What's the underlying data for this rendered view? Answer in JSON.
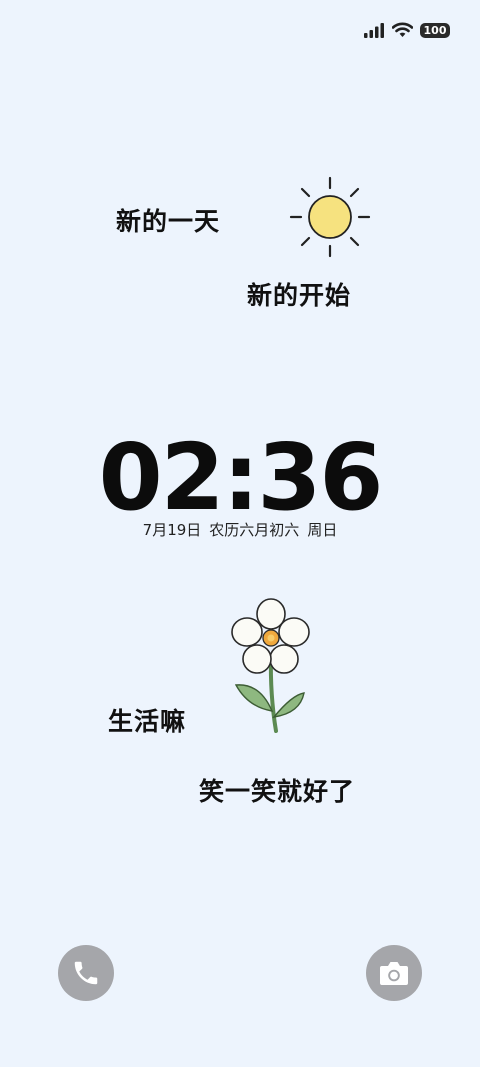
{
  "status_bar": {
    "battery": "100"
  },
  "quotes": {
    "line1": "新的一天",
    "line2": "新的开始",
    "line3": "生活嘛",
    "line4": "笑一笑就好了"
  },
  "clock": {
    "time": "02:36",
    "date": "7月19日",
    "lunar": "农历六月初六",
    "weekday": "周日"
  },
  "icons": {
    "sun": "sun-icon",
    "flower": "flower-icon",
    "phone": "phone-icon",
    "camera": "camera-icon"
  },
  "colors": {
    "background": "#edf4fd",
    "sun": "#f6e27f",
    "button": "#a5a6aa"
  }
}
